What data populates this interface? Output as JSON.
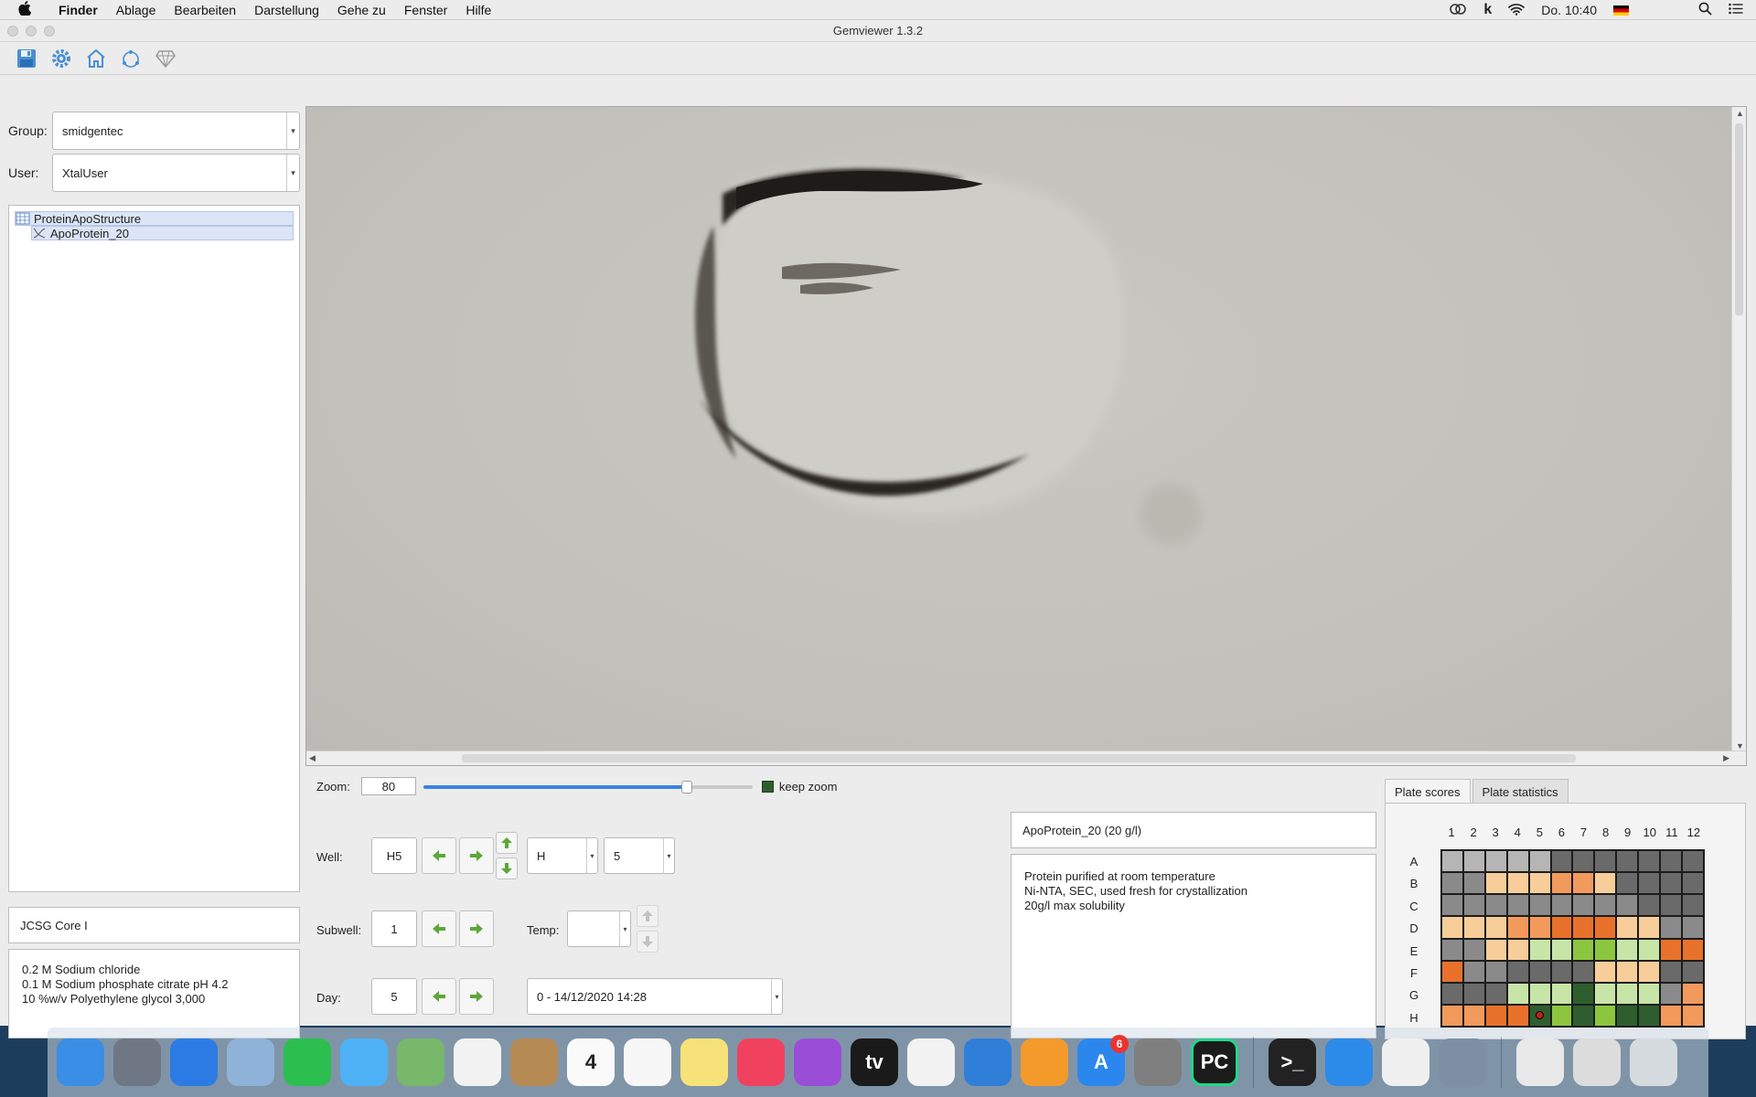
{
  "menubar": {
    "app_name": "Finder",
    "items": [
      "Ablage",
      "Bearbeiten",
      "Darstellung",
      "Gehe zu",
      "Fenster",
      "Hilfe"
    ],
    "clock": "Do. 10:40",
    "k_glyph": "k"
  },
  "window": {
    "title": "Gemviewer 1.3.2",
    "toolbar": [
      "save-icon",
      "gear-icon",
      "home-icon",
      "refresh-icon",
      "diamond-icon"
    ]
  },
  "left": {
    "group_label": "Group:",
    "group_value": "smidgentec",
    "user_label": "User:",
    "user_value": "XtalUser",
    "tree": {
      "root": "ProteinApoStructure",
      "child": "ApoProtein_20"
    },
    "screen_name": "JCSG Core I",
    "conditions": [
      "0.2 M Sodium chloride",
      "0.1 M Sodium phosphate citrate pH 4.2",
      "10 %w/v Polyethylene glycol 3,000"
    ]
  },
  "zoom": {
    "label": "Zoom:",
    "value": "80",
    "slider_fraction": 0.8,
    "keep_zoom_label": "keep zoom"
  },
  "well": {
    "label": "Well:",
    "value": "H5",
    "row_select": "H",
    "col_select": "5"
  },
  "subwell": {
    "label": "Subwell:",
    "value": "1",
    "temp_label": "Temp:",
    "temp_value": ""
  },
  "day": {
    "label": "Day:",
    "value": "5",
    "timepoint": "0 - 14/12/2020 14:28"
  },
  "info": {
    "title": "ApoProtein_20 (20 g/l)",
    "notes": [
      "Protein purified at room temperature",
      "Ni-NTA, SEC, used fresh for crystallization",
      "20g/l max solubility"
    ]
  },
  "plate": {
    "tabs": [
      "Plate scores",
      "Plate statistics"
    ],
    "active_tab": 0,
    "columns": [
      "1",
      "2",
      "3",
      "4",
      "5",
      "6",
      "7",
      "8",
      "9",
      "10",
      "11",
      "12"
    ],
    "rows": [
      "A",
      "B",
      "C",
      "D",
      "E",
      "F",
      "G",
      "H"
    ],
    "score_colors": {
      "L": "#b5b5b5",
      "M": "#8a8a8a",
      "D": "#6a6a6a",
      "P": "#f7cd9a",
      "O": "#f29a5c",
      "R": "#e8722c",
      "G": "#c8e5a8",
      "Y": "#8cc63f",
      "K": "#2e5e2e"
    },
    "grid": [
      [
        "L",
        "L",
        "L",
        "L",
        "L",
        "D",
        "D",
        "D",
        "D",
        "D",
        "D",
        "D"
      ],
      [
        "M",
        "M",
        "P",
        "P",
        "P",
        "O",
        "O",
        "P",
        "D",
        "D",
        "D",
        "D"
      ],
      [
        "M",
        "M",
        "M",
        "M",
        "M",
        "M",
        "M",
        "M",
        "M",
        "D",
        "D",
        "D"
      ],
      [
        "P",
        "P",
        "P",
        "O",
        "O",
        "R",
        "R",
        "R",
        "P",
        "P",
        "M",
        "M"
      ],
      [
        "M",
        "M",
        "P",
        "P",
        "G",
        "G",
        "Y",
        "Y",
        "G",
        "G",
        "R",
        "R"
      ],
      [
        "R",
        "M",
        "M",
        "D",
        "D",
        "D",
        "D",
        "P",
        "P",
        "P",
        "D",
        "D"
      ],
      [
        "D",
        "D",
        "D",
        "G",
        "G",
        "G",
        "K",
        "G",
        "G",
        "G",
        "M",
        "O"
      ],
      [
        "O",
        "O",
        "R",
        "R",
        "K",
        "Y",
        "K",
        "Y",
        "K",
        "K",
        "O",
        "O"
      ]
    ],
    "selected_well": {
      "row": 7,
      "col": 4
    }
  },
  "dock": {
    "apps": [
      {
        "name": "finder-icon",
        "color": "#3a8ee6",
        "glyph": ""
      },
      {
        "name": "launchpad-icon",
        "color": "#6f7784",
        "glyph": ""
      },
      {
        "name": "safari-icon",
        "color": "#2c7be5",
        "glyph": ""
      },
      {
        "name": "mail-icon",
        "color": "#8fb2d9",
        "glyph": ""
      },
      {
        "name": "facetime-icon",
        "color": "#2cbf4f",
        "glyph": ""
      },
      {
        "name": "messages-icon",
        "color": "#4fb1f5",
        "glyph": ""
      },
      {
        "name": "maps-icon",
        "color": "#77b86a",
        "glyph": ""
      },
      {
        "name": "photos-icon",
        "color": "#f2f2f2",
        "glyph": ""
      },
      {
        "name": "contacts-icon",
        "color": "#b58a52",
        "glyph": ""
      },
      {
        "name": "calendar-icon",
        "color": "#fafafa",
        "glyph": "4"
      },
      {
        "name": "reminders-icon",
        "color": "#f7f7f7",
        "glyph": ""
      },
      {
        "name": "notes-icon",
        "color": "#f7e27a",
        "glyph": ""
      },
      {
        "name": "music-icon",
        "color": "#f0425f",
        "glyph": ""
      },
      {
        "name": "podcasts-icon",
        "color": "#9a4ed8",
        "glyph": ""
      },
      {
        "name": "tv-icon",
        "color": "#1a1a1a",
        "glyph": "tv"
      },
      {
        "name": "numbers-icon",
        "color": "#f2f2f2",
        "glyph": ""
      },
      {
        "name": "keynote-icon",
        "color": "#2f7fd8",
        "glyph": ""
      },
      {
        "name": "pages-icon",
        "color": "#f39a2b",
        "glyph": ""
      },
      {
        "name": "appstore-icon",
        "color": "#2b87ee",
        "glyph": "A",
        "badge": "6"
      },
      {
        "name": "system-preferences-icon",
        "color": "#7f7f7f",
        "glyph": ""
      },
      {
        "name": "pycharm-icon",
        "color": "#1b1b1b",
        "glyph": "PC"
      }
    ],
    "apps_right": [
      {
        "name": "terminal-icon",
        "color": "#222222",
        "glyph": ">_"
      },
      {
        "name": "xcode-icon",
        "color": "#2c8ae8",
        "glyph": ""
      },
      {
        "name": "textedit-icon",
        "color": "#f0f0f0",
        "glyph": ""
      },
      {
        "name": "rocket-icon",
        "color": "#7d8fa3",
        "glyph": ""
      }
    ],
    "apps_far": [
      {
        "name": "archive-icon",
        "color": "#e8e8e8",
        "glyph": ""
      },
      {
        "name": "downloads-stack-icon",
        "color": "#dcdcdc",
        "glyph": ""
      },
      {
        "name": "trash-icon",
        "color": "#d6dbe0",
        "glyph": ""
      }
    ]
  }
}
